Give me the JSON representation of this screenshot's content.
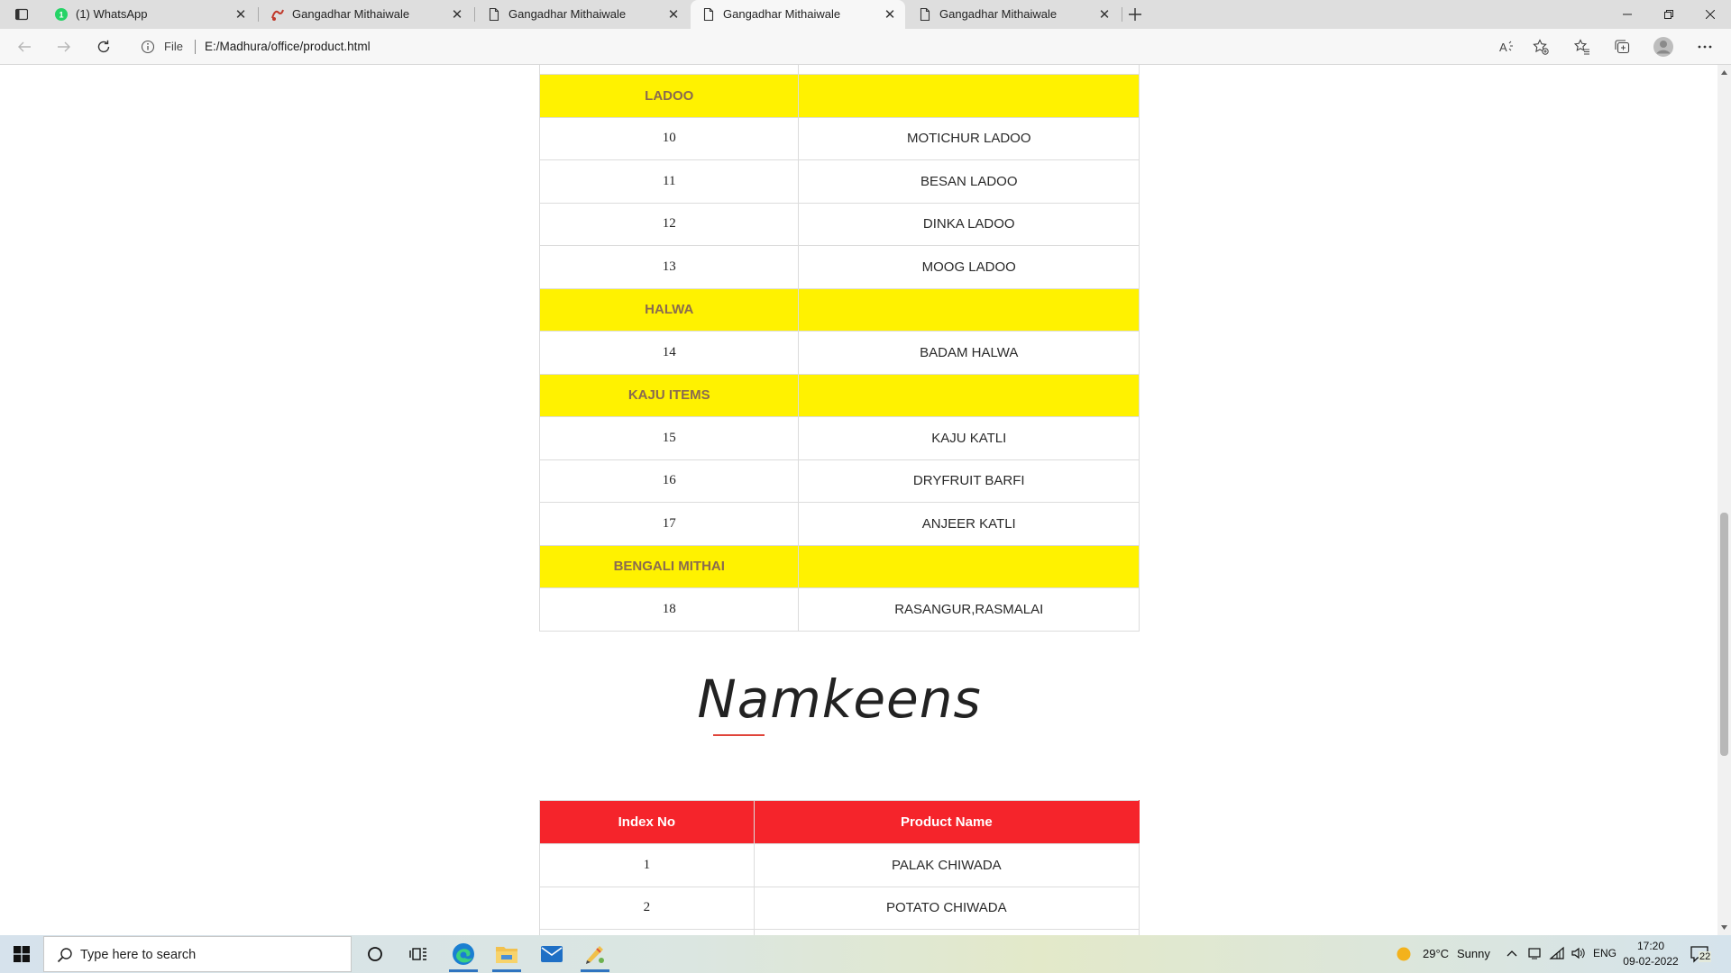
{
  "browser": {
    "tabs": [
      {
        "title": "(1) WhatsApp",
        "icon": "whatsapp-icon",
        "active": false
      },
      {
        "title": "Gangadhar Mithaiwale",
        "icon": "brand-logo-icon",
        "active": false
      },
      {
        "title": "Gangadhar Mithaiwale",
        "icon": "page-icon",
        "active": false
      },
      {
        "title": "Gangadhar Mithaiwale",
        "icon": "page-icon",
        "active": true
      },
      {
        "title": "Gangadhar Mithaiwale",
        "icon": "page-icon",
        "active": false
      }
    ],
    "address": {
      "scheme_label": "File",
      "url": "E:/Madhura/office/product.html"
    }
  },
  "page": {
    "sweets_table": {
      "rows": [
        {
          "type": "category",
          "label": "LADOO"
        },
        {
          "type": "item",
          "index": "10",
          "name": "MOTICHUR LADOO"
        },
        {
          "type": "item",
          "index": "11",
          "name": "BESAN LADOO"
        },
        {
          "type": "item",
          "index": "12",
          "name": "DINKA LADOO"
        },
        {
          "type": "item",
          "index": "13",
          "name": "MOOG LADOO"
        },
        {
          "type": "category",
          "label": "HALWA"
        },
        {
          "type": "item",
          "index": "14",
          "name": "BADAM HALWA"
        },
        {
          "type": "category",
          "label": "KAJU ITEMS"
        },
        {
          "type": "item",
          "index": "15",
          "name": "KAJU KATLI"
        },
        {
          "type": "item",
          "index": "16",
          "name": "DRYFRUIT BARFI"
        },
        {
          "type": "item",
          "index": "17",
          "name": "ANJEER KATLI"
        },
        {
          "type": "category",
          "label": "BENGALI MITHAI"
        },
        {
          "type": "item",
          "index": "18",
          "name": "RASANGUR,RASMALAI"
        }
      ]
    },
    "namkeens_heading": "Namkeens",
    "namkeens_table": {
      "headers": [
        "Index No",
        "Product Name"
      ],
      "rows": [
        {
          "index": "1",
          "name": "PALAK CHIWADA"
        },
        {
          "index": "2",
          "name": "POTATO CHIWADA"
        }
      ]
    },
    "colors": {
      "category_bg": "#fff200",
      "category_text": "#8a6b4f",
      "header_bg": "#f5242b"
    }
  },
  "taskbar": {
    "search_placeholder": "Type here to search",
    "weather": {
      "temp": "29°C",
      "condition": "Sunny"
    },
    "language": "ENG",
    "time": "17:20",
    "date": "09-02-2022",
    "notifications": "22"
  }
}
